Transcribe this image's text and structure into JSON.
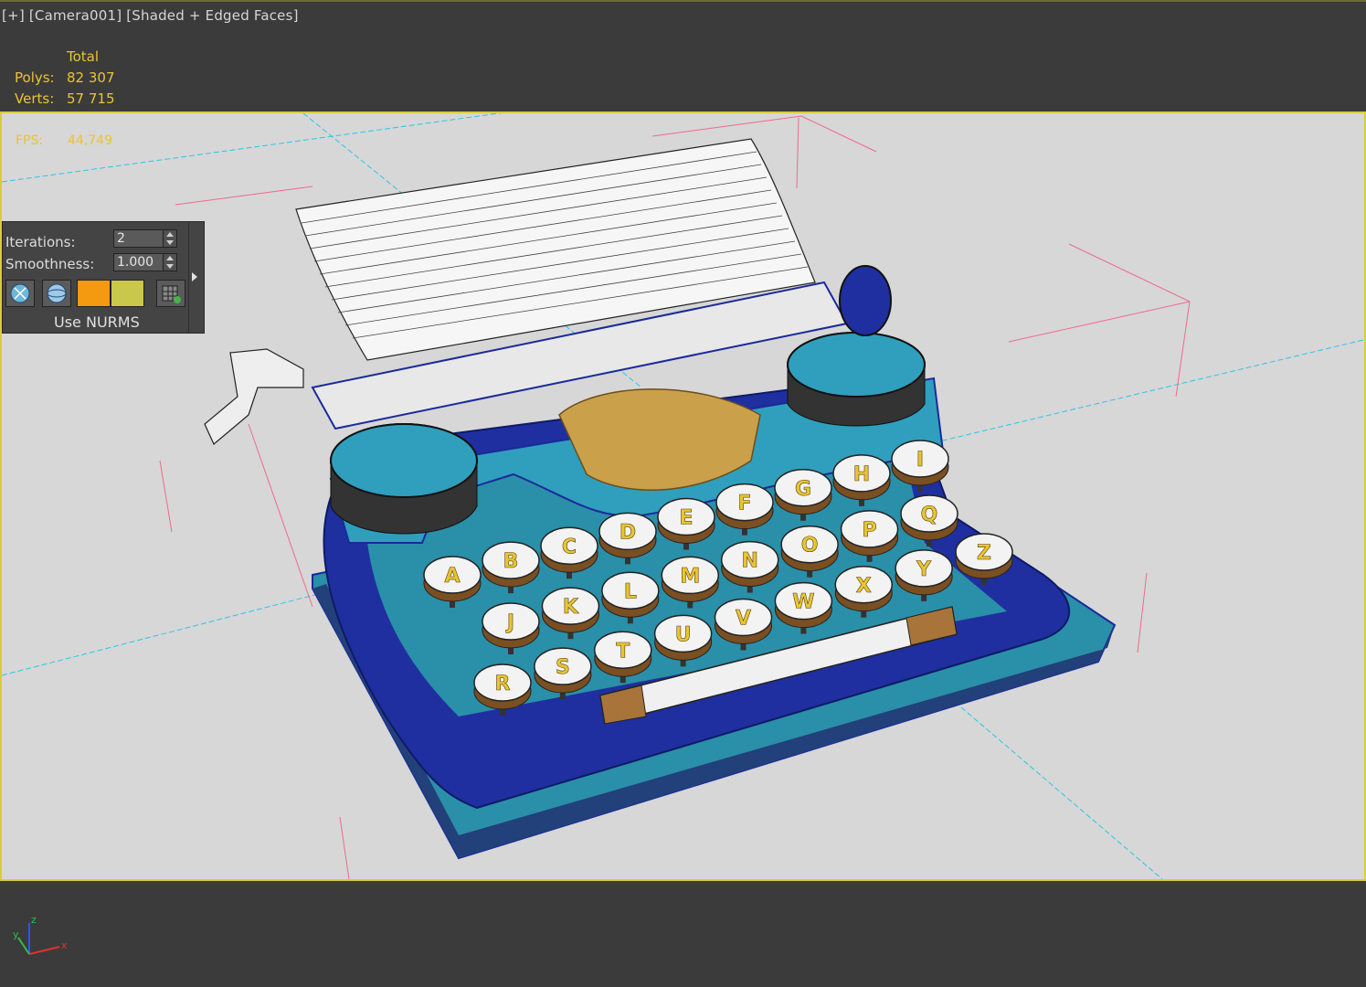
{
  "viewport": {
    "label": "[+] [Camera001] [Shaded + Edged Faces]"
  },
  "stats": {
    "header": "Total",
    "polys_label": "Polys:",
    "polys_value": "82 307",
    "verts_label": "Verts:",
    "verts_value": "57 715",
    "fps_label": "FPS:",
    "fps_value": "44,749"
  },
  "nurms_panel": {
    "iterations_label": "Iterations:",
    "iterations_value": "2",
    "smoothness_label": "Smoothness:",
    "smoothness_value": "1.000",
    "use_nurms_label": "Use NURMS",
    "swatch_colors": [
      "#f39a10",
      "#c9c84a"
    ]
  },
  "scene": {
    "keys_row1": [
      "A",
      "B",
      "C",
      "D",
      "E",
      "F",
      "G",
      "H",
      "I"
    ],
    "keys_row2": [
      "J",
      "K",
      "L",
      "M",
      "N",
      "O",
      "P",
      "Q"
    ],
    "keys_row3": [
      "R",
      "S",
      "T",
      "U",
      "V",
      "W",
      "X",
      "Y",
      "Z"
    ],
    "axis_labels": [
      "z",
      "x",
      "y"
    ],
    "colors": {
      "body": "#2a8fa8",
      "dark_blue": "#1a2a9a",
      "paper": "#f4f4f4",
      "key_gold": "#e8c531",
      "grid_cyan": "#29c6e6",
      "grid_pink": "#f06a8a"
    }
  }
}
